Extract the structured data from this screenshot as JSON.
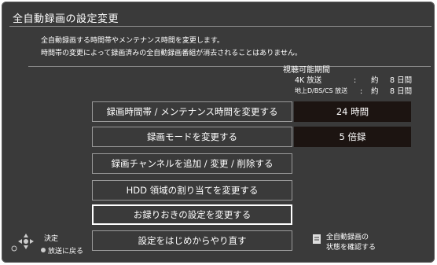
{
  "title": "全自動録画の設定変更",
  "description": {
    "line1": "全自動録画する時間帯やメンテナンス時間を変更します。",
    "line2": "時間帯の変更によって録画済みの全自動録画番組が消去されることはありません。"
  },
  "viewing_period": {
    "heading": "視聴可能期間",
    "rows": [
      {
        "label": "4K 放送",
        "sep": ":",
        "prefix": "約",
        "value": "8 日間"
      },
      {
        "label": "地上D/BS/CS 放送",
        "sep": ":",
        "prefix": "約",
        "value": "8 日間"
      }
    ]
  },
  "menu": [
    {
      "label": "録画時間帯 / メンテナンス時間を変更する",
      "value": "24 時間"
    },
    {
      "label": "録画モードを変更する",
      "value": "5 倍録"
    },
    {
      "label": "録画チャンネルを追加 / 変更 / 削除する"
    },
    {
      "label": "HDD 領域の割り当てを変更する"
    },
    {
      "label": "お録りおきの設定を変更する"
    },
    {
      "label": "設定をはじめからやり直す"
    }
  ],
  "help": {
    "decide": "決定",
    "return": "放送に戻る",
    "status_line1": "全自動録画の",
    "status_line2": "状態を確認する"
  },
  "colors": {
    "panel_bg": "#3a3a3a",
    "value_bg": "#1c1411",
    "text": "#ffffff",
    "button_border": "#9a9a9a",
    "selected_border": "#ffffff"
  }
}
